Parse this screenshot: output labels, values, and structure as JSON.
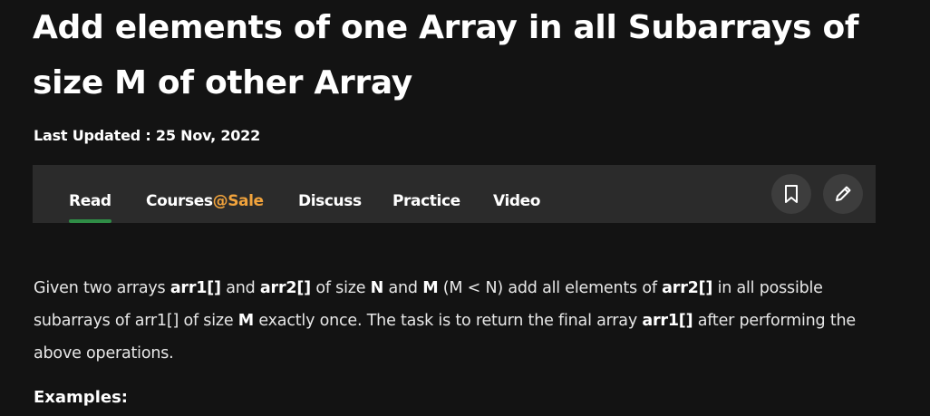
{
  "article": {
    "title": "Add elements of one Array in all Subarrays of size M of other Array",
    "last_updated": "Last Updated : 25 Nov, 2022"
  },
  "tabs": {
    "read": "Read",
    "courses_prefix": "Courses",
    "courses_accent": "@Sale",
    "discuss": "Discuss",
    "practice": "Practice",
    "video": "Video",
    "active": "Read"
  },
  "actions": {
    "bookmark_icon": "bookmark-icon",
    "edit_icon": "pencil-icon"
  },
  "body": {
    "p1": "Given two arrays ",
    "arr1": "arr1[]",
    "p2": " and ",
    "arr2": "arr2[]",
    "p3": " of size ",
    "n": "N",
    "p4": " and ",
    "m": "M",
    "p5": " (M < N) add all elements of ",
    "arr2b": "arr2[]",
    "p6": " in all possible subarrays of arr1[] of size ",
    "m2": "M",
    "p7": " exactly once. The task is to return the final array ",
    "arr1b": "arr1[]",
    "p8": " after performing the above operations."
  },
  "examples_heading": "Examples:",
  "colors": {
    "background": "#131313",
    "tabbar": "#2b2b2b",
    "accent_orange": "#f1a33c",
    "active_underline": "#2f8d46",
    "icon_button": "#3d3d3d"
  }
}
